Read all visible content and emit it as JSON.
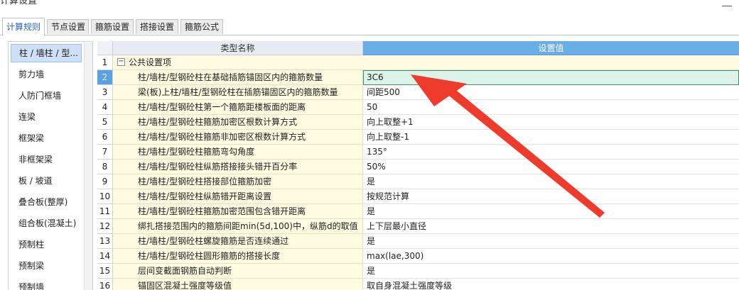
{
  "window": {
    "title": "计算设置"
  },
  "tabs": [
    {
      "label": "计算规则",
      "active": true
    },
    {
      "label": "节点设置",
      "active": false
    },
    {
      "label": "箍筋设置",
      "active": false
    },
    {
      "label": "搭接设置",
      "active": false
    },
    {
      "label": "箍筋公式",
      "active": false
    }
  ],
  "sidebar": {
    "items": [
      {
        "label": "柱 / 墙柱 / 型...",
        "active": true
      },
      {
        "label": "剪力墙"
      },
      {
        "label": "人防门框墙"
      },
      {
        "label": "连梁"
      },
      {
        "label": "框架梁"
      },
      {
        "label": "非框架梁"
      },
      {
        "label": "板 / 坡道"
      },
      {
        "label": "叠合板(整厚)"
      },
      {
        "label": "组合板(混凝土)"
      },
      {
        "label": "预制柱"
      },
      {
        "label": "预制梁"
      },
      {
        "label": "预制墙"
      }
    ]
  },
  "grid": {
    "headers": {
      "type": "类型名称",
      "value": "设置值"
    },
    "group": {
      "num": "1",
      "expander": "−",
      "label": "公共设置项"
    },
    "rows": [
      {
        "num": "2",
        "name": "柱/墙柱/型钢砼柱在基础插筋锚固区内的箍筋数量",
        "value": "3C6",
        "selected": true
      },
      {
        "num": "3",
        "name": "梁(板)上柱/墙柱/型钢砼柱在插筋锚固区内的箍筋数量",
        "value": "间距500"
      },
      {
        "num": "4",
        "name": "柱/墙柱/型钢砼柱第一个箍筋距楼板面的距离",
        "value": "50"
      },
      {
        "num": "5",
        "name": "柱/墙柱/型钢砼柱箍筋加密区根数计算方式",
        "value": "向上取整+1"
      },
      {
        "num": "6",
        "name": "柱/墙柱/型钢砼柱箍筋非加密区根数计算方式",
        "value": "向上取整-1"
      },
      {
        "num": "7",
        "name": "柱/墙柱/型钢砼柱箍筋弯勾角度",
        "value": "135°"
      },
      {
        "num": "8",
        "name": "柱/墙柱/型钢砼柱纵筋搭接接头错开百分率",
        "value": "50%"
      },
      {
        "num": "9",
        "name": "柱/墙柱/型钢砼柱搭接部位箍筋加密",
        "value": "是"
      },
      {
        "num": "10",
        "name": "柱/墙柱/型钢砼柱纵筋错开距离设置",
        "value": "按规范计算"
      },
      {
        "num": "11",
        "name": "柱/墙柱/型钢砼柱箍筋加密范围包含错开距离",
        "value": "是"
      },
      {
        "num": "12",
        "name": "绑扎搭接范围内的箍筋间距min(5d,100)中，纵筋d的取值",
        "value": "上下层最小直径"
      },
      {
        "num": "13",
        "name": "柱/墙柱/型钢砼柱螺旋箍筋是否连续通过",
        "value": "是"
      },
      {
        "num": "14",
        "name": "柱/墙柱/型钢砼柱圆形箍筋的搭接长度",
        "value": "max(lae,300)"
      },
      {
        "num": "15",
        "name": "层间变截面钢筋自动判断",
        "value": "是"
      },
      {
        "num": "16",
        "name": "锚固区混凝土强度等级值",
        "value": "取自身混凝土强度等级"
      }
    ]
  },
  "annotation": {
    "arrow_color": "#ee3b2b"
  }
}
